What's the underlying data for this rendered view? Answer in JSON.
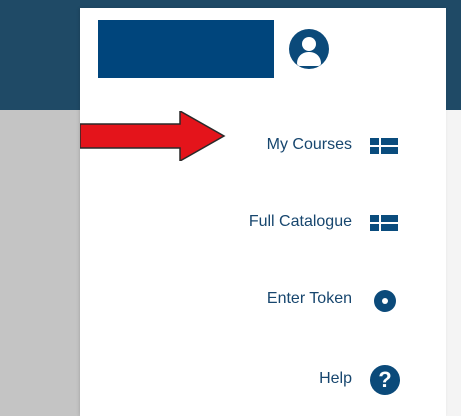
{
  "menu": {
    "items": [
      {
        "label": "My Courses",
        "icon": "grid-icon"
      },
      {
        "label": "Full Catalogue",
        "icon": "grid-icon"
      },
      {
        "label": "Enter Token",
        "icon": "token-icon"
      },
      {
        "label": "Help",
        "icon": "help-icon"
      }
    ],
    "help_glyph": "?"
  },
  "colors": {
    "header": "#1f4a66",
    "panel": "#ffffff",
    "background": "#c4c4c4",
    "accent": "#0b4a7a",
    "link": "#17466e",
    "user_box": "#00457c",
    "arrow": "#e4141b"
  }
}
